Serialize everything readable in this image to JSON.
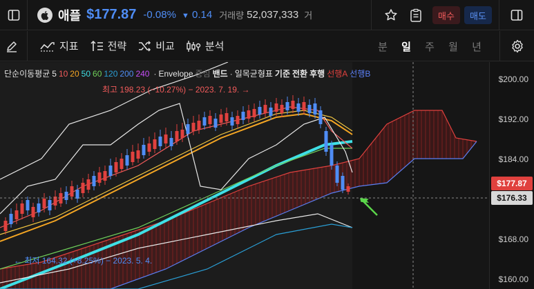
{
  "header": {
    "logo_icon": "apple-icon",
    "name": "애플",
    "price": "$177.87",
    "change_pct": "-0.08%",
    "change_arrow": "▼",
    "change_abs": "0.14",
    "volume_label": "거래량",
    "volume": "52,037,333",
    "volume_suffix": "거",
    "buy_label": "매수",
    "sell_label": "매도",
    "colors": {
      "down": "#4f8df5",
      "up": "#f25b5b"
    }
  },
  "toolbar": {
    "indicator_label": "지표",
    "strategy_label": "전략",
    "compare_label": "비교",
    "analysis_label": "분석",
    "intervals": [
      "분",
      "일",
      "주",
      "월",
      "년"
    ],
    "active_interval": "일"
  },
  "legend": {
    "prefix": "단순이동평균",
    "periods": [
      {
        "label": "5",
        "color": "#e8e8e8"
      },
      {
        "label": "10",
        "color": "#f25b5b"
      },
      {
        "label": "20",
        "color": "#f5a623"
      },
      {
        "label": "50",
        "color": "#3fe0e6"
      },
      {
        "label": "60",
        "color": "#6fcf5a"
      },
      {
        "label": "120",
        "color": "#2a9fd6"
      },
      {
        "label": "200",
        "color": "#4f8df5"
      },
      {
        "label": "240",
        "color": "#c54df5"
      }
    ],
    "sep1": "·",
    "envelope": "Envelope",
    "envelope_mid": "중심",
    "band": "밴드",
    "sep2": "·",
    "ichimoku": "일목균형표",
    "base": "기준",
    "conv": "전환",
    "lag": "후행",
    "span_a": "선행A",
    "span_b": "선행B"
  },
  "annotations": {
    "high": "최고 198.23 (−10.27%) − 2023. 7. 19. →",
    "low": "← 최저 164.32 (+8.25%) − 2023. 5. 4."
  },
  "yaxis": {
    "ticks": [
      "$200.00",
      "$192.00",
      "$184.00",
      "$176.00",
      "$168.00",
      "$160.00"
    ],
    "last_price_tag": "$177.87",
    "cursor_price_tag": "$176.33"
  }
}
